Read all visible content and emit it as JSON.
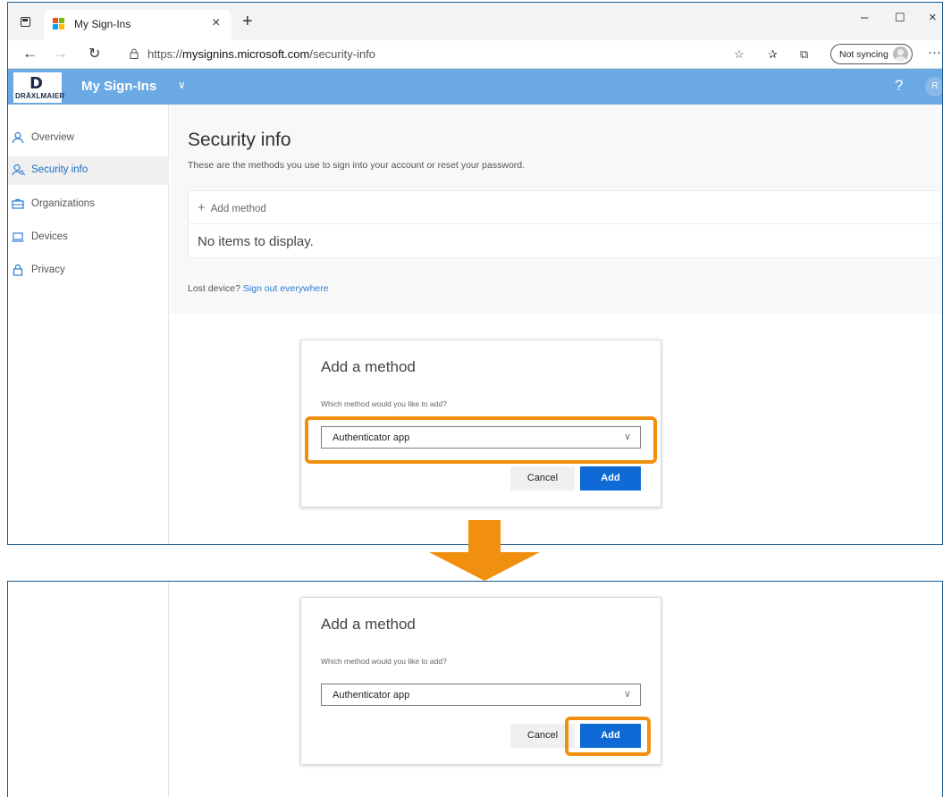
{
  "browser": {
    "tab_title": "My Sign-Ins",
    "tab_close": "×",
    "new_tab": "+",
    "url_prefix": "https://",
    "url_host": "mysignins.microsoft.com",
    "url_path": "/security-info",
    "sync_label": "Not syncing",
    "more": "···",
    "window_controls": {
      "minimize": "–",
      "maximize": "☐",
      "close": "×"
    }
  },
  "header": {
    "logo_text": "DRÄXLMAIER",
    "logo_letter": "D",
    "app_name": "My Sign-Ins",
    "help": "?",
    "user_initial": "R"
  },
  "sidebar": {
    "items": [
      {
        "label": "Overview",
        "icon": "person-icon"
      },
      {
        "label": "Security info",
        "icon": "person-key-icon",
        "active": true
      },
      {
        "label": "Organizations",
        "icon": "briefcase-icon"
      },
      {
        "label": "Devices",
        "icon": "laptop-icon"
      },
      {
        "label": "Privacy",
        "icon": "lock-icon"
      }
    ]
  },
  "main": {
    "title": "Security info",
    "subtitle": "These are the methods you use to sign into your account or reset your password.",
    "add_method": "Add method",
    "empty_text": "No items to display.",
    "lost_device": "Lost device?",
    "sign_out": "Sign out everywhere"
  },
  "dialog": {
    "title": "Add a method",
    "question": "Which method would you like to add?",
    "selected": "Authenticator app",
    "cancel": "Cancel",
    "add": "Add"
  },
  "colors": {
    "header_blue": "#6aa9e3",
    "primary_button": "#0f6ad6",
    "highlight_orange": "#f0900e",
    "panel_border": "#1e5a8a"
  }
}
